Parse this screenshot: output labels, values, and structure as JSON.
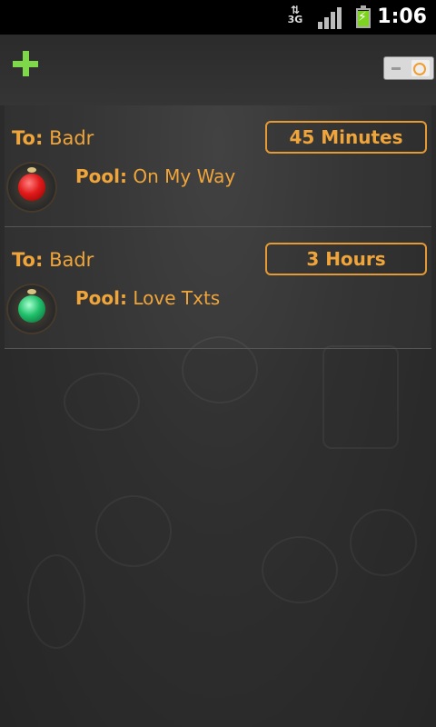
{
  "status_bar": {
    "network": "3G",
    "time": "1:06",
    "icons": [
      "data-arrows-icon",
      "signal-icon",
      "battery-charging-icon"
    ]
  },
  "action_bar": {
    "add_icon": "plus-icon",
    "toggle_icon": "toggle-switch-icon"
  },
  "items": [
    {
      "to_label": "To:",
      "to_value": "Badr",
      "timer": "45 Minutes",
      "pool_label": "Pool:",
      "pool_value": "On My Way",
      "led": "red"
    },
    {
      "to_label": "To:",
      "to_value": "Badr",
      "timer": "3 Hours",
      "pool_label": "Pool:",
      "pool_value": "Love Txts",
      "led": "green"
    }
  ],
  "colors": {
    "accent": "#f0a53a",
    "add_green": "#7fd84a",
    "background": "#2f2f2f"
  }
}
